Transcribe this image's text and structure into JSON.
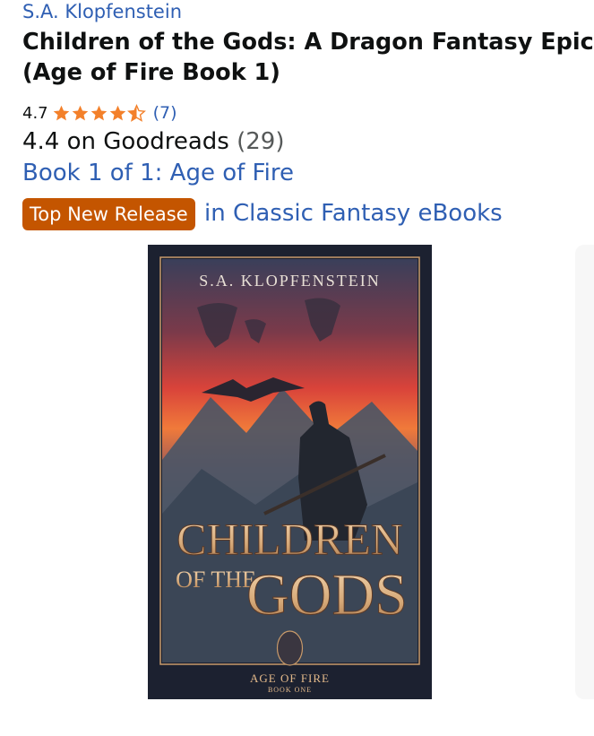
{
  "product": {
    "author": "S.A. Klopfenstein",
    "title": "Children of the Gods: A Dragon Fantasy Epic (Age of Fire Book 1)",
    "rating": {
      "value": "4.7",
      "stars": 4.5,
      "count": "(7)"
    },
    "goodreads": {
      "text": "4.4 on Goodreads",
      "count": "(29)"
    },
    "series": "Book 1 of 1: Age of Fire",
    "badge": "Top New Release",
    "category": "in Classic Fantasy eBooks"
  },
  "cover": {
    "author": "S.A. KLOPFENSTEIN",
    "title_line1": "CHILDREN",
    "title_of_the": "OF THE",
    "title_gods": "GODS",
    "series": "AGE OF FIRE",
    "book": "BOOK ONE"
  },
  "colors": {
    "link": "#2f5fb3",
    "star": "#f3802a",
    "badge": "#c45500"
  }
}
